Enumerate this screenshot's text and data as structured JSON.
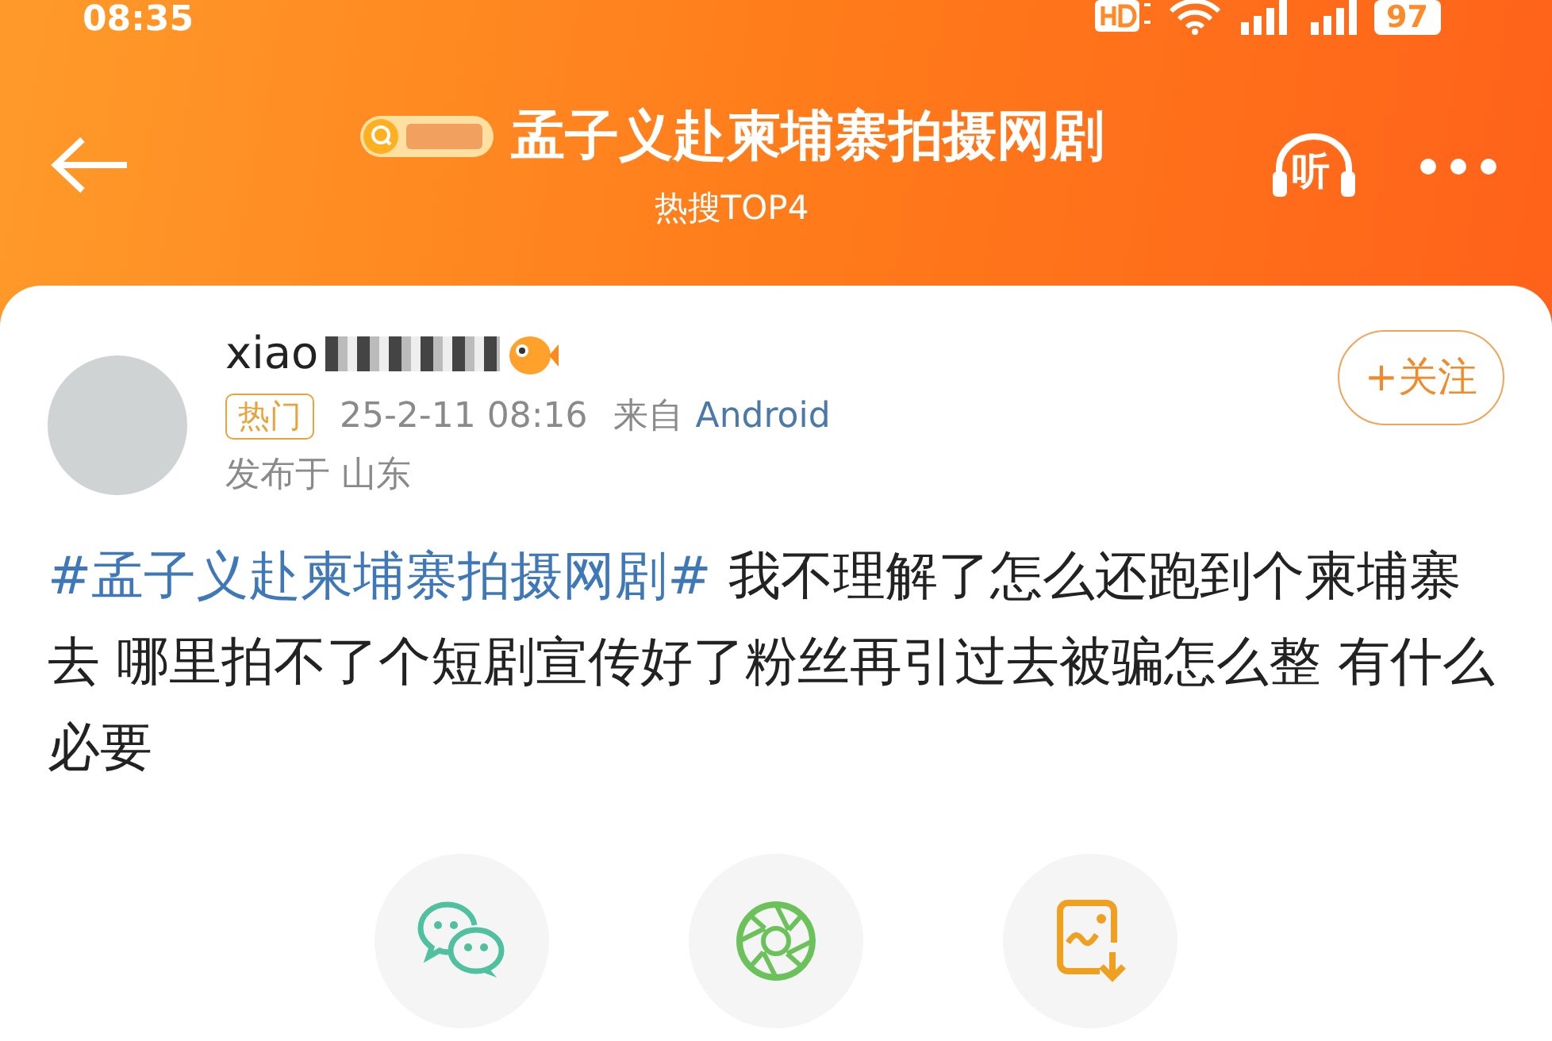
{
  "status_bar": {
    "time": "08:35",
    "battery": "97"
  },
  "header": {
    "title": "孟子义赴柬埔寨拍摄网剧",
    "subtitle": "热搜TOP4",
    "listen_label": "听"
  },
  "post": {
    "username": "xiao",
    "badge": "热门",
    "timestamp": "25-2-11 08:16",
    "source_prefix": "来自",
    "source": "Android",
    "location": "发布于 山东",
    "follow_button": "+关注",
    "hashtag": "#孟子义赴柬埔寨拍摄网剧#",
    "text": " 我不理解了怎么还跑到个柬埔寨去 哪里拍不了个短剧宣传好了粉丝再引过去被骗怎么整  有什么必要"
  },
  "share_targets": [
    {
      "kind": "chat"
    },
    {
      "kind": "aperture"
    },
    {
      "kind": "save-image"
    }
  ]
}
